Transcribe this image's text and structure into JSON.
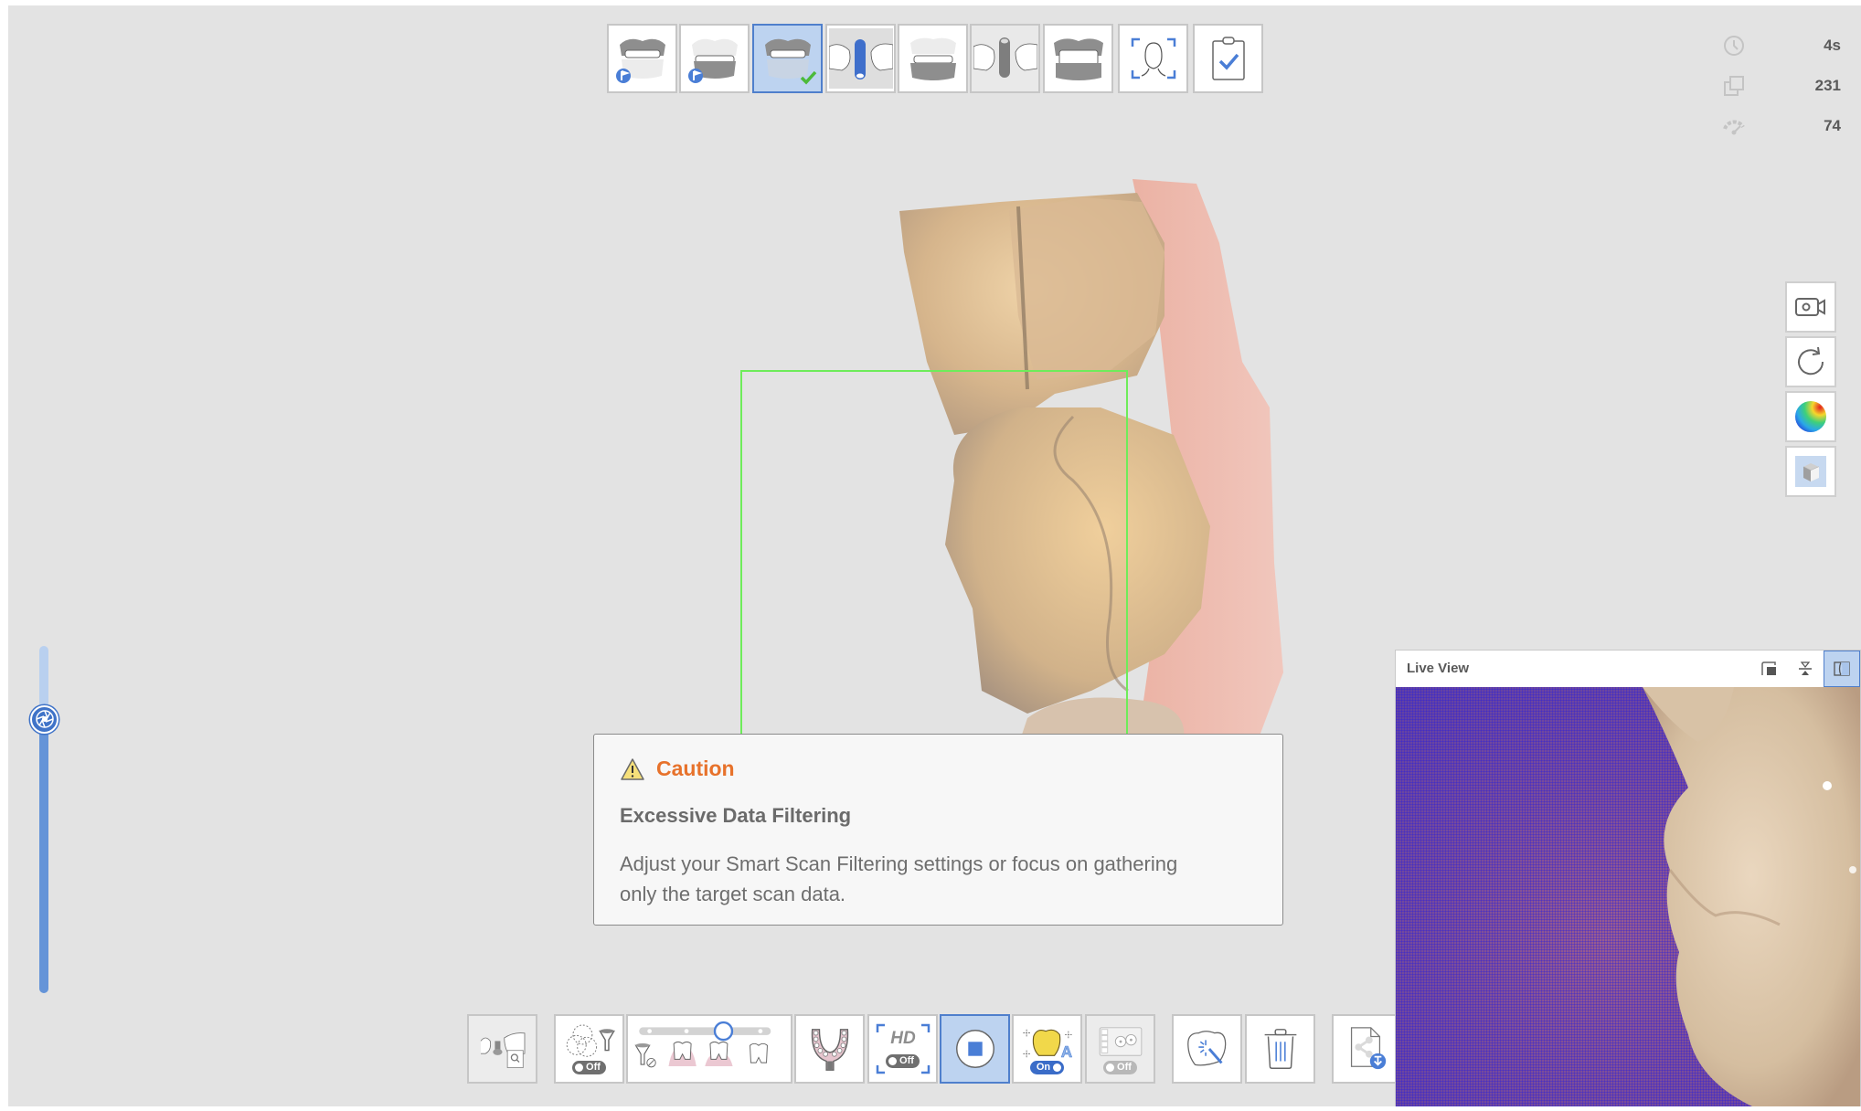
{
  "top_toolbar": {
    "steps": [
      {
        "name": "maxilla-scan-step",
        "label": "Maxilla",
        "state": "normal",
        "badge": "flag"
      },
      {
        "name": "mandible-scan-step",
        "label": "Mandible",
        "state": "normal",
        "badge": "flag"
      },
      {
        "name": "maxilla-done-step",
        "label": "Maxilla Scan",
        "state": "active",
        "badge": "check"
      },
      {
        "name": "maxilla-scanbody-step",
        "label": "Maxilla Scanbody",
        "state": "normal",
        "badge": ""
      },
      {
        "name": "mandible-step",
        "label": "Mandible Scan",
        "state": "normal",
        "badge": ""
      },
      {
        "name": "mandible-scanbody-step",
        "label": "Mandible Scanbody",
        "state": "disabled",
        "badge": ""
      },
      {
        "name": "occlusion-step",
        "label": "Occlusion",
        "state": "normal",
        "badge": ""
      },
      {
        "name": "face-scan-step",
        "label": "Face Scan",
        "state": "normal",
        "badge": ""
      },
      {
        "name": "review-step",
        "label": "Review",
        "state": "normal",
        "badge": ""
      }
    ]
  },
  "stats": {
    "time": {
      "icon": "clock-icon",
      "value": "4s"
    },
    "shots": {
      "icon": "copy-icon",
      "value": "231"
    },
    "speed": {
      "icon": "gauge-icon",
      "value": "74"
    }
  },
  "side_tools": [
    {
      "name": "record-video-button",
      "icon": "video-camera-icon"
    },
    {
      "name": "reset-view-button",
      "icon": "rotate-icon"
    },
    {
      "name": "reliability-map-button",
      "icon": "color-sphere-icon"
    },
    {
      "name": "view-mode-button",
      "icon": "cube-icon"
    }
  ],
  "caution": {
    "title": "Caution",
    "subtitle": "Excessive Data Filtering",
    "message": "Adjust your Smart Scan Filtering settings or focus on gathering only the target scan data.",
    "colors": {
      "title": "#e7722b"
    }
  },
  "scan_depth_slider": {
    "value_fraction": 0.79
  },
  "bottom_toolbar": {
    "library_button": {
      "label": "Scanbody Library"
    },
    "smart_filter": {
      "label": "Smart Scan Filtering",
      "toggle": "Off"
    },
    "filter_level": {
      "label": "Filtering Level",
      "levels": 4,
      "selected_index": 2
    },
    "arch_button": {
      "label": "Arch"
    },
    "hd_button": {
      "label": "HD",
      "toggle": "Off"
    },
    "record_button": {
      "label": "Stop Scan"
    },
    "ai_button": {
      "label": "AI Scan",
      "toggle": "On"
    },
    "texture_button": {
      "label": "Texture",
      "toggle": "Off"
    },
    "magic_button": {
      "label": "Auto Trim"
    },
    "trash_button": {
      "label": "Delete"
    },
    "export_button": {
      "label": "Export"
    }
  },
  "live_view": {
    "title": "Live View"
  },
  "colors": {
    "accent": "#4f7fcc",
    "roi": "#6eec5a",
    "active_bg": "#bdd3f0"
  }
}
